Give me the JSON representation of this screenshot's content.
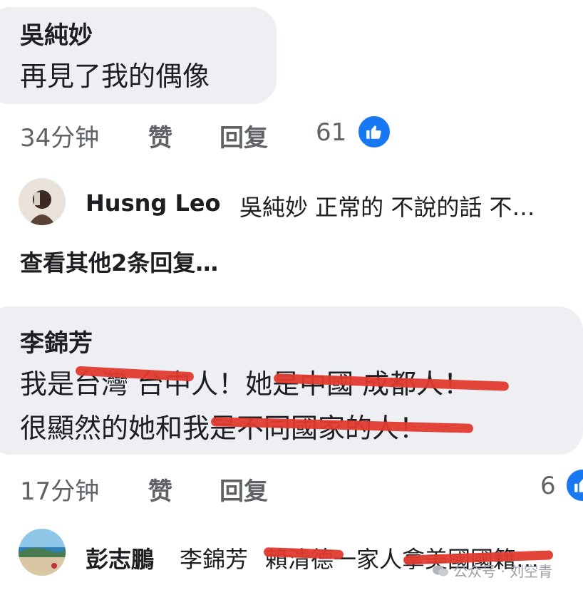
{
  "comment1": {
    "author": "吳純妙",
    "text": "再見了我的偶像",
    "time": "34分钟",
    "like_label": "赞",
    "reply_label": "回复",
    "like_count": "61"
  },
  "reply1": {
    "name": "Husng Leo",
    "text": "吳純妙 正常的 不說的話 不…"
  },
  "view_more": "查看其他2条回复…",
  "comment2": {
    "author": "李錦芳",
    "line1": "我是台灣 台中人！她是中國 成都人！",
    "line2": "很顯然的她和我是不同國家的人！",
    "time": "17分钟",
    "like_label": "赞",
    "reply_label": "回复",
    "like_count": "6"
  },
  "reply2": {
    "name": "彭志鵬",
    "mention": "李錦芳",
    "text": "賴清德一家人拿美國國籍…"
  },
  "watermark": "公众号 · 刘空青",
  "colors": {
    "bubble": "#eeeff2",
    "like_blue": "#1877f2",
    "redaction": "#e03a2e",
    "meta_gray": "#5f6368"
  },
  "icons": [
    "thumbs-up-icon",
    "wechat-icon"
  ]
}
